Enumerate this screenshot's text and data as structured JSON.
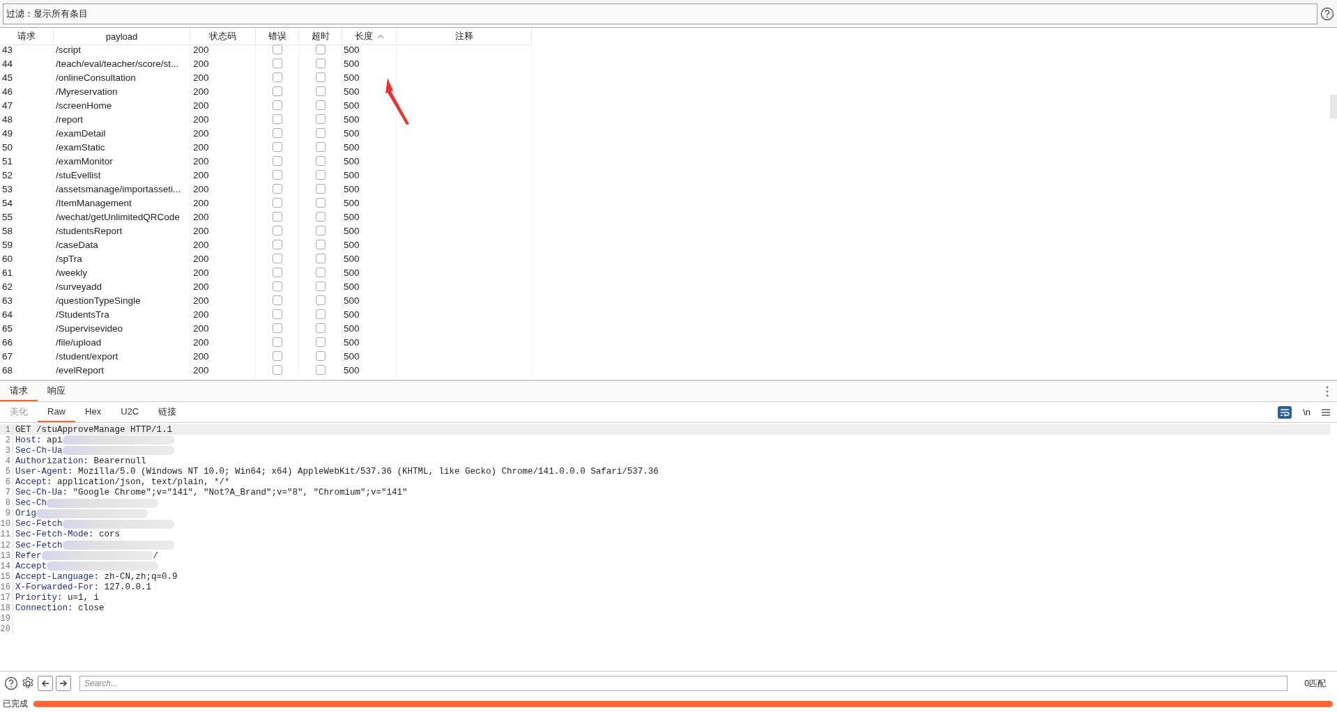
{
  "filter": {
    "text": "过滤：显示所有条目"
  },
  "table": {
    "columns": [
      {
        "label": "请求",
        "sorted": false
      },
      {
        "label": "payload",
        "sorted": false
      },
      {
        "label": "状态码",
        "sorted": false
      },
      {
        "label": "错误",
        "sorted": false
      },
      {
        "label": "超时",
        "sorted": false
      },
      {
        "label": "长度",
        "sorted": true
      },
      {
        "label": "注释",
        "sorted": false
      }
    ],
    "rows": [
      {
        "request": "43",
        "payload": "/script",
        "status": "200",
        "error": false,
        "timeout": false,
        "length": "500"
      },
      {
        "request": "44",
        "payload": "/teach/eval/teacher/score/st...",
        "status": "200",
        "error": false,
        "timeout": false,
        "length": "500"
      },
      {
        "request": "45",
        "payload": "/onlineConsultation",
        "status": "200",
        "error": false,
        "timeout": false,
        "length": "500"
      },
      {
        "request": "46",
        "payload": "/Myreservation",
        "status": "200",
        "error": false,
        "timeout": false,
        "length": "500"
      },
      {
        "request": "47",
        "payload": "/screenHome",
        "status": "200",
        "error": false,
        "timeout": false,
        "length": "500"
      },
      {
        "request": "48",
        "payload": "/report",
        "status": "200",
        "error": false,
        "timeout": false,
        "length": "500"
      },
      {
        "request": "49",
        "payload": "/examDetail",
        "status": "200",
        "error": false,
        "timeout": false,
        "length": "500"
      },
      {
        "request": "50",
        "payload": "/examStatic",
        "status": "200",
        "error": false,
        "timeout": false,
        "length": "500"
      },
      {
        "request": "51",
        "payload": "/examMonitor",
        "status": "200",
        "error": false,
        "timeout": false,
        "length": "500"
      },
      {
        "request": "52",
        "payload": "/stuEvellist",
        "status": "200",
        "error": false,
        "timeout": false,
        "length": "500"
      },
      {
        "request": "53",
        "payload": "/assetsmanage/importasseti...",
        "status": "200",
        "error": false,
        "timeout": false,
        "length": "500"
      },
      {
        "request": "54",
        "payload": "/ItemManagement",
        "status": "200",
        "error": false,
        "timeout": false,
        "length": "500"
      },
      {
        "request": "55",
        "payload": "/wechat/getUnlimitedQRCode",
        "status": "200",
        "error": false,
        "timeout": false,
        "length": "500"
      },
      {
        "request": "58",
        "payload": "/studentsReport",
        "status": "200",
        "error": false,
        "timeout": false,
        "length": "500"
      },
      {
        "request": "59",
        "payload": "/caseData",
        "status": "200",
        "error": false,
        "timeout": false,
        "length": "500"
      },
      {
        "request": "60",
        "payload": "/spTra",
        "status": "200",
        "error": false,
        "timeout": false,
        "length": "500"
      },
      {
        "request": "61",
        "payload": "/weekly",
        "status": "200",
        "error": false,
        "timeout": false,
        "length": "500"
      },
      {
        "request": "62",
        "payload": "/surveyadd",
        "status": "200",
        "error": false,
        "timeout": false,
        "length": "500"
      },
      {
        "request": "63",
        "payload": "/questionTypeSingle",
        "status": "200",
        "error": false,
        "timeout": false,
        "length": "500"
      },
      {
        "request": "64",
        "payload": "/StudentsTra",
        "status": "200",
        "error": false,
        "timeout": false,
        "length": "500"
      },
      {
        "request": "65",
        "payload": "/Supervisevideo",
        "status": "200",
        "error": false,
        "timeout": false,
        "length": "500"
      },
      {
        "request": "66",
        "payload": "/file/upload",
        "status": "200",
        "error": false,
        "timeout": false,
        "length": "500"
      },
      {
        "request": "67",
        "payload": "/student/export",
        "status": "200",
        "error": false,
        "timeout": false,
        "length": "500"
      },
      {
        "request": "68",
        "payload": "/evelReport",
        "status": "200",
        "error": false,
        "timeout": false,
        "length": "500"
      }
    ]
  },
  "panel_tabs": [
    {
      "label": "请求",
      "selected": true
    },
    {
      "label": "响应",
      "selected": false
    }
  ],
  "view_tabs": [
    {
      "label": "美化",
      "selected": false
    },
    {
      "label": "Raw",
      "selected": true
    },
    {
      "label": "Hex",
      "selected": false
    },
    {
      "label": "U2C",
      "selected": false
    },
    {
      "label": "链接",
      "selected": false
    }
  ],
  "toolbar": {
    "newline_label": "\\n",
    "wrap_on": true
  },
  "code_lines": [
    {
      "number": "1",
      "kind": "request",
      "text": "GET /stuApproveManage HTTP/1.1",
      "current": true
    },
    {
      "number": "2",
      "kind": "header",
      "key": "Host:",
      "value": "api",
      "redacted": true,
      "current": false
    },
    {
      "number": "3",
      "kind": "header",
      "key": "Sec-Ch-Ua",
      "redacted": true,
      "current": false
    },
    {
      "number": "4",
      "kind": "header",
      "key": "Authorization:",
      "value": "Bearernull",
      "current": false
    },
    {
      "number": "5",
      "kind": "header",
      "key": "User-Agent:",
      "value": "Mozilla/5.0 (Windows NT 10.0; Win64; x64) AppleWebKit/537.36 (KHTML, like Gecko) Chrome/141.0.0.0 Safari/537.36",
      "current": false
    },
    {
      "number": "6",
      "kind": "header",
      "key": "Accept:",
      "value": "application/json, text/plain, */*",
      "current": false
    },
    {
      "number": "7",
      "kind": "header",
      "key": "Sec-Ch-Ua:",
      "value": "\"Google Chrome\";v=\"141\", \"Not?A_Brand\";v=\"8\", \"Chromium\";v=\"141\"",
      "current": false
    },
    {
      "number": "8",
      "kind": "header",
      "key": "Sec-Ch",
      "redacted": true,
      "current": false
    },
    {
      "number": "9",
      "kind": "header",
      "key": "Orig",
      "redacted": true,
      "current": false
    },
    {
      "number": "10",
      "kind": "header",
      "key": "Sec-Fetch",
      "redacted": true,
      "current": false
    },
    {
      "number": "11",
      "kind": "header",
      "key": "Sec-Fetch-Mode:",
      "value": "cors",
      "current": false
    },
    {
      "number": "12",
      "kind": "header",
      "key": "Sec-Fetch",
      "redacted": true,
      "current": false
    },
    {
      "number": "13",
      "kind": "header",
      "key": "Refer",
      "redacted": true,
      "tail": "/",
      "current": false
    },
    {
      "number": "14",
      "kind": "header",
      "key": "Accept",
      "redacted": true,
      "current": false
    },
    {
      "number": "15",
      "kind": "header",
      "key": "Accept-Language:",
      "value": "zh-CN,zh;q=0.9",
      "current": false
    },
    {
      "number": "16",
      "kind": "header",
      "key": "X-Forwarded-For:",
      "value": "127.0.0.1",
      "current": false
    },
    {
      "number": "17",
      "kind": "header",
      "key": "Priority:",
      "value": "u=1, i",
      "current": false
    },
    {
      "number": "18",
      "kind": "header",
      "key": "Connection:",
      "value": "close",
      "current": false
    },
    {
      "number": "19",
      "kind": "empty",
      "current": false
    },
    {
      "number": "20",
      "kind": "empty",
      "current": false
    }
  ],
  "search": {
    "placeholder": "Search...",
    "matches": "0匹配"
  },
  "status": {
    "text": "已完成",
    "level": 1
  }
}
